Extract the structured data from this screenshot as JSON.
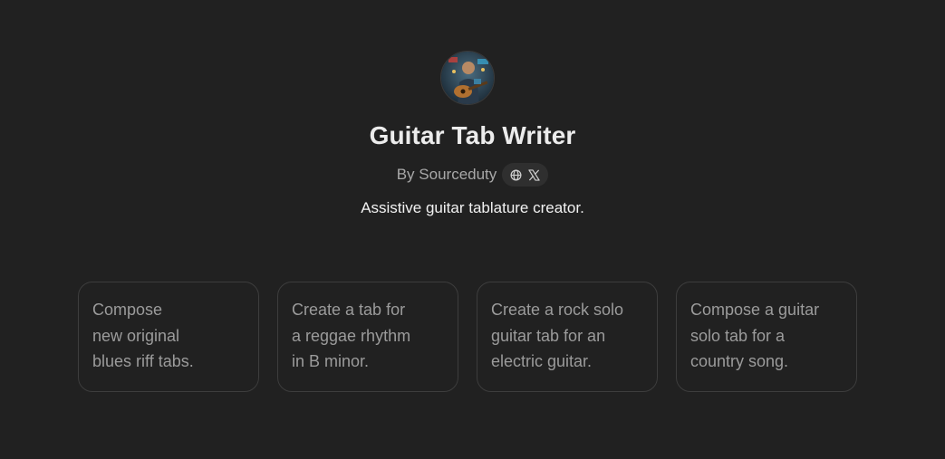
{
  "gpt": {
    "title": "Guitar Tab Writer",
    "byline": "By Sourceduty",
    "description": "Assistive guitar tablature creator.",
    "social_icons": [
      "globe-icon",
      "x-logo-icon"
    ]
  },
  "starters": [
    {
      "text": "Compose\nnew original\nblues riff tabs."
    },
    {
      "text": "Create a tab for\na reggae rhythm\nin B minor."
    },
    {
      "text": "Create a rock solo\nguitar tab for an\nelectric guitar."
    },
    {
      "text": "Compose a guitar\nsolo tab for a\ncountry song."
    }
  ],
  "colors": {
    "background": "#212121",
    "card_border": "#3d3d3d",
    "muted_text": "#9b9b9b",
    "title_text": "#ececec"
  }
}
